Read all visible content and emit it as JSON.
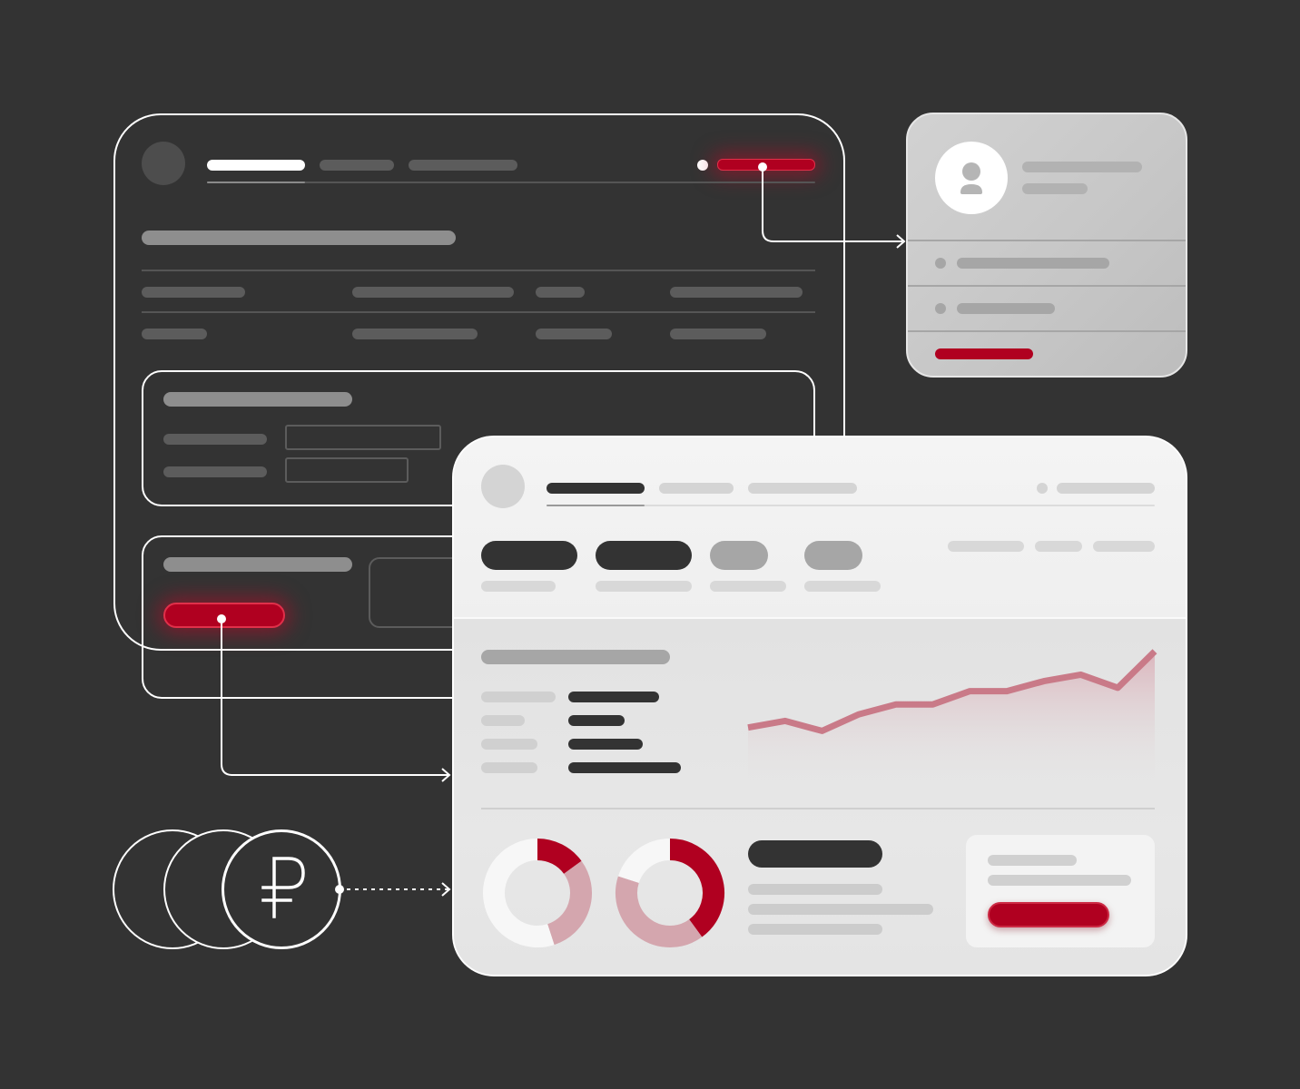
{
  "currency_symbol": "₽",
  "colors": {
    "background": "#333333",
    "accent_red": "#B00020",
    "chart_line": "#C97A88",
    "chart_fill": "#D9A6B0",
    "donut_light": "#D4A6AE",
    "white": "#FFFFFF"
  },
  "icons": {
    "profile_avatar": "user-icon",
    "currency": "ruble-icon",
    "arrows": "arrow-right-icon"
  },
  "chart_data": [
    {
      "type": "area",
      "series": [
        {
          "values": [
            2,
            4,
            1,
            6,
            9,
            9,
            13,
            13,
            16,
            18,
            14,
            25
          ]
        }
      ]
    },
    {
      "type": "pie",
      "values": [
        15,
        30,
        55
      ]
    },
    {
      "type": "pie",
      "values": [
        40,
        40,
        20
      ]
    }
  ]
}
